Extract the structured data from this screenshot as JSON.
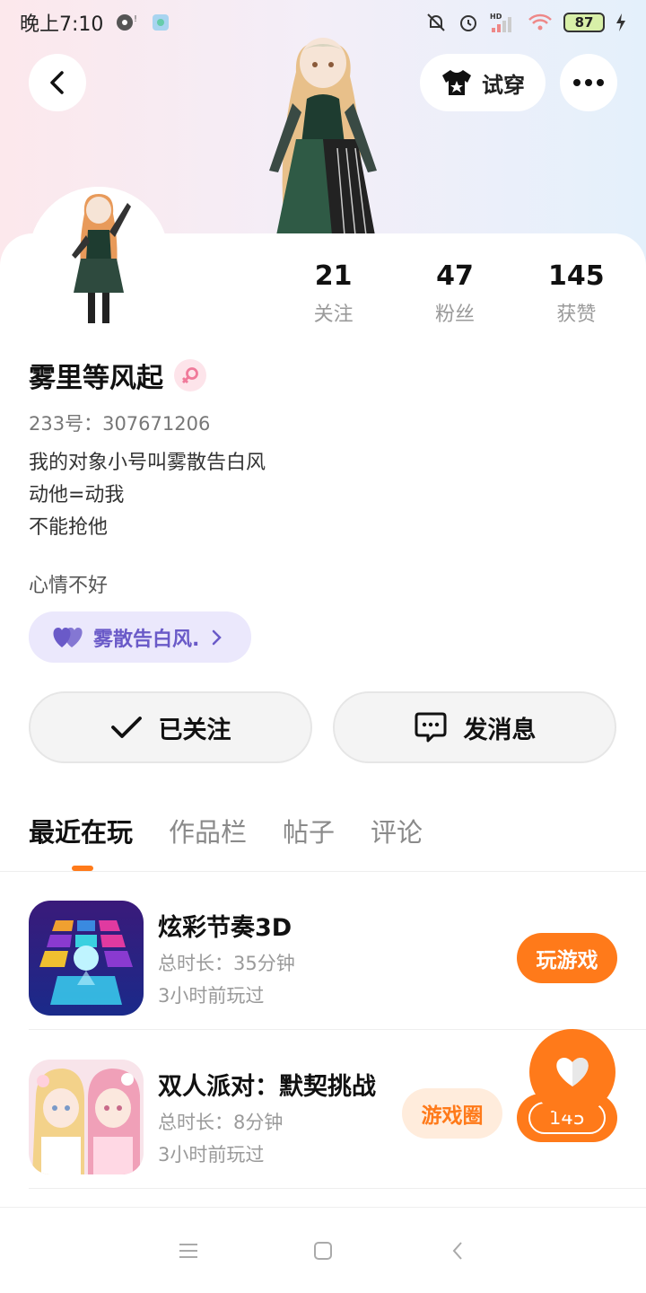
{
  "status_bar": {
    "time": "晚上7:10",
    "battery": "87",
    "network": "HD"
  },
  "header": {
    "try_on_label": "试穿"
  },
  "profile": {
    "stats": [
      {
        "value": "21",
        "label": "关注"
      },
      {
        "value": "47",
        "label": "粉丝"
      },
      {
        "value": "145",
        "label": "获赞"
      }
    ],
    "name": "雾里等风起",
    "gender": "female",
    "uid": "233号：307671206",
    "bio_lines": [
      "我的对象小号叫雾散告白风",
      "动他=动我",
      "不能抢他"
    ],
    "mood": "心情不好",
    "cp_tag": "雾散告白风."
  },
  "actions": {
    "followed_label": "已关注",
    "message_label": "发消息"
  },
  "tabs": [
    {
      "label": "最近在玩",
      "active": true
    },
    {
      "label": "作品栏",
      "active": false
    },
    {
      "label": "帖子",
      "active": false
    },
    {
      "label": "评论",
      "active": false
    }
  ],
  "games": [
    {
      "title": "炫彩节奏3D",
      "duration": "总时长：35分钟",
      "last_played": "3小时前玩过",
      "primary_button": "玩游戏"
    },
    {
      "title": "双人派对：默契挑战",
      "duration": "总时长：8分钟",
      "last_played": "3小时前玩过",
      "secondary_button": "游戏圈"
    }
  ],
  "like_float": {
    "count": "145"
  },
  "icons": {
    "back": "chevron-left-icon",
    "try_on": "tshirt-icon",
    "more": "more-dots-icon",
    "gender": "female-symbol-icon",
    "cp_tag": "double-heart-icon",
    "followed": "check-icon",
    "message": "chat-bubble-icon",
    "like": "heart-icon"
  },
  "colors": {
    "accent": "#ff7a1a",
    "cp_tag_bg": "#ebe8fc",
    "cp_tag_text": "#6a5ac8"
  }
}
